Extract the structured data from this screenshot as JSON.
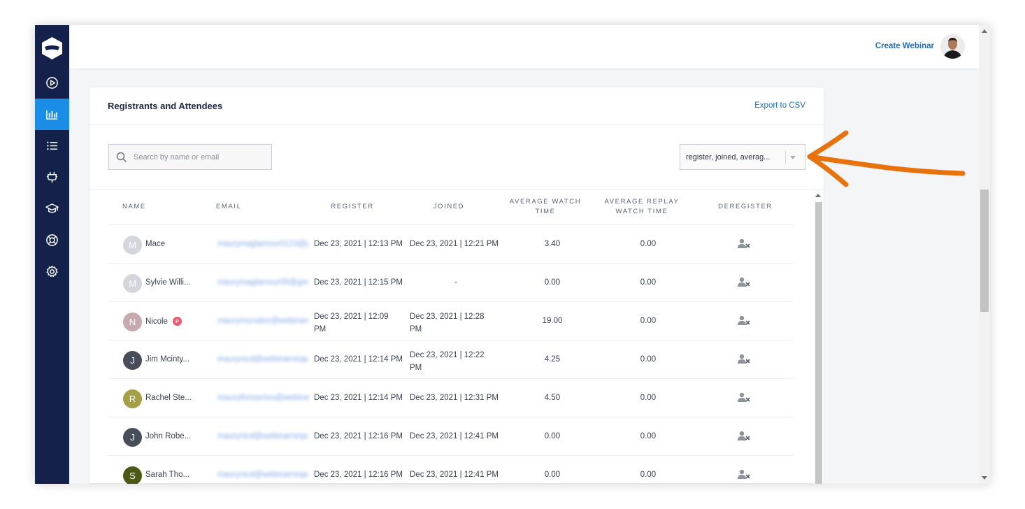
{
  "header": {
    "create_webinar": "Create Webinar"
  },
  "card": {
    "title": "Registrants and Attendees",
    "export": "Export to CSV",
    "search_placeholder": "Search by name or email",
    "columns_select": "register, joined, averag..."
  },
  "columns": {
    "name": "NAME",
    "email": "EMAIL",
    "register": "REGISTER",
    "joined": "JOINED",
    "avg_watch_1": "AVERAGE WATCH",
    "avg_watch_2": "TIME",
    "avg_replay_1": "AVERAGE REPLAY",
    "avg_replay_2": "WATCH TIME",
    "deregister": "DEREGISTER"
  },
  "rows": [
    {
      "initial": "M",
      "name": "Mace",
      "email": "maurymaglamour0123@gmail.com",
      "register_1": "Dec 23, 2021 | 12:13 PM",
      "register_2": "",
      "joined_1": "Dec 23, 2021 | 12:21 PM",
      "joined_2": "",
      "avg_watch": "3.40",
      "avg_replay": "0.00"
    },
    {
      "initial": "M",
      "name": "Sylvie Willi...",
      "email": "maurymaglamour05@gmail.com",
      "register_1": "Dec 23, 2021 | 12:15 PM",
      "register_2": "",
      "joined_1": "-",
      "joined_2": "",
      "avg_watch": "0.00",
      "avg_replay": "0.00"
    },
    {
      "initial": "N",
      "name": "Nicole",
      "email": "maurymonaleo@webinarninja.com",
      "register_1": "Dec 23, 2021 | 12:09",
      "register_2": "PM",
      "joined_1": "Dec 23, 2021 | 12:28",
      "joined_2": "PM",
      "avg_watch": "19.00",
      "avg_replay": "0.00"
    },
    {
      "initial": "J",
      "name": "Jim Mcinty...",
      "email": "maurynicd@webinarninja.com",
      "register_1": "Dec 23, 2021 | 12:14 PM",
      "register_2": "",
      "joined_1": "Dec 23, 2021 | 12:22",
      "joined_2": "PM",
      "avg_watch": "4.25",
      "avg_replay": "0.00"
    },
    {
      "initial": "R",
      "name": "Rachel Ste...",
      "email": "maurythreserios@webinarninja.com",
      "register_1": "Dec 23, 2021 | 12:14 PM",
      "register_2": "",
      "joined_1": "Dec 23, 2021 | 12:31 PM",
      "joined_2": "",
      "avg_watch": "4.50",
      "avg_replay": "0.00"
    },
    {
      "initial": "J",
      "name": "John Robe...",
      "email": "maurynicd@webinarninja.com",
      "register_1": "Dec 23, 2021 | 12:16 PM",
      "register_2": "",
      "joined_1": "Dec 23, 2021 | 12:41 PM",
      "joined_2": "",
      "avg_watch": "0.00",
      "avg_replay": "0.00"
    },
    {
      "initial": "S",
      "name": "Sarah Tho...",
      "email": "maurynicd@webinarninjas.com",
      "register_1": "Dec 23, 2021 | 12:16 PM",
      "register_2": "",
      "joined_1": "Dec 23, 2021 | 12:41 PM",
      "joined_2": "",
      "avg_watch": "0.00",
      "avg_replay": "0.00"
    }
  ],
  "badge": "P",
  "colors": {
    "sidebar": "#14214a",
    "accent": "#1a8ee6",
    "link": "#1a6fd1",
    "annotation_arrow": "#e8720c",
    "avatar_light": "#d4d6dc",
    "avatar_pink": "#c8a9ae",
    "avatar_dark": "#474e59",
    "avatar_olive": "#a4a046",
    "avatar_darkgreen": "#4a5a14"
  }
}
